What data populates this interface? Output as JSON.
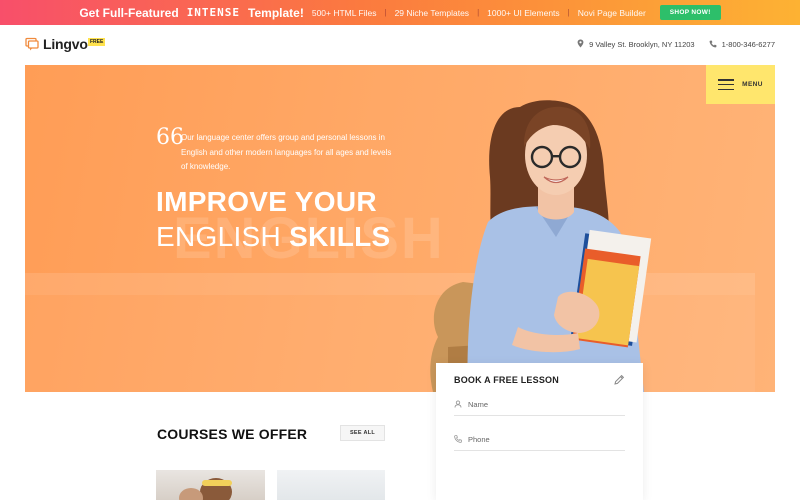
{
  "promo": {
    "lead": "Get Full-Featured",
    "brand": "INTENSE",
    "tail": "Template!",
    "features": [
      "500+ HTML Files",
      "29 Niche Templates",
      "1000+ UI Elements",
      "Novi Page Builder"
    ],
    "separator": "|",
    "cta": "SHOP NOW!"
  },
  "header": {
    "logo_text": "Lingvo",
    "logo_badge": "FREE",
    "address": "9 Valley St. Brooklyn, NY 11203",
    "phone": "1-800-346-6277"
  },
  "menu": {
    "label": "MENU"
  },
  "hero": {
    "quote_mark": "66",
    "description": "Our language center offers group and personal lessons in English and other modern languages for all ages and levels of knowledge.",
    "title_line1": "IMPROVE YOUR",
    "title_line2_light": "ENGLISH",
    "title_line2_bold": "SKILLS",
    "watermark": "ENGLISH"
  },
  "booking": {
    "title": "BOOK A FREE LESSON",
    "name_placeholder": "Name",
    "phone_placeholder": "Phone"
  },
  "courses": {
    "title": "COURSES WE OFFER",
    "see_all": "SEE ALL"
  },
  "colors": {
    "accent_orange": "#ff9d56",
    "menu_yellow": "#ffe66d",
    "shop_green": "#2dbf6a"
  }
}
